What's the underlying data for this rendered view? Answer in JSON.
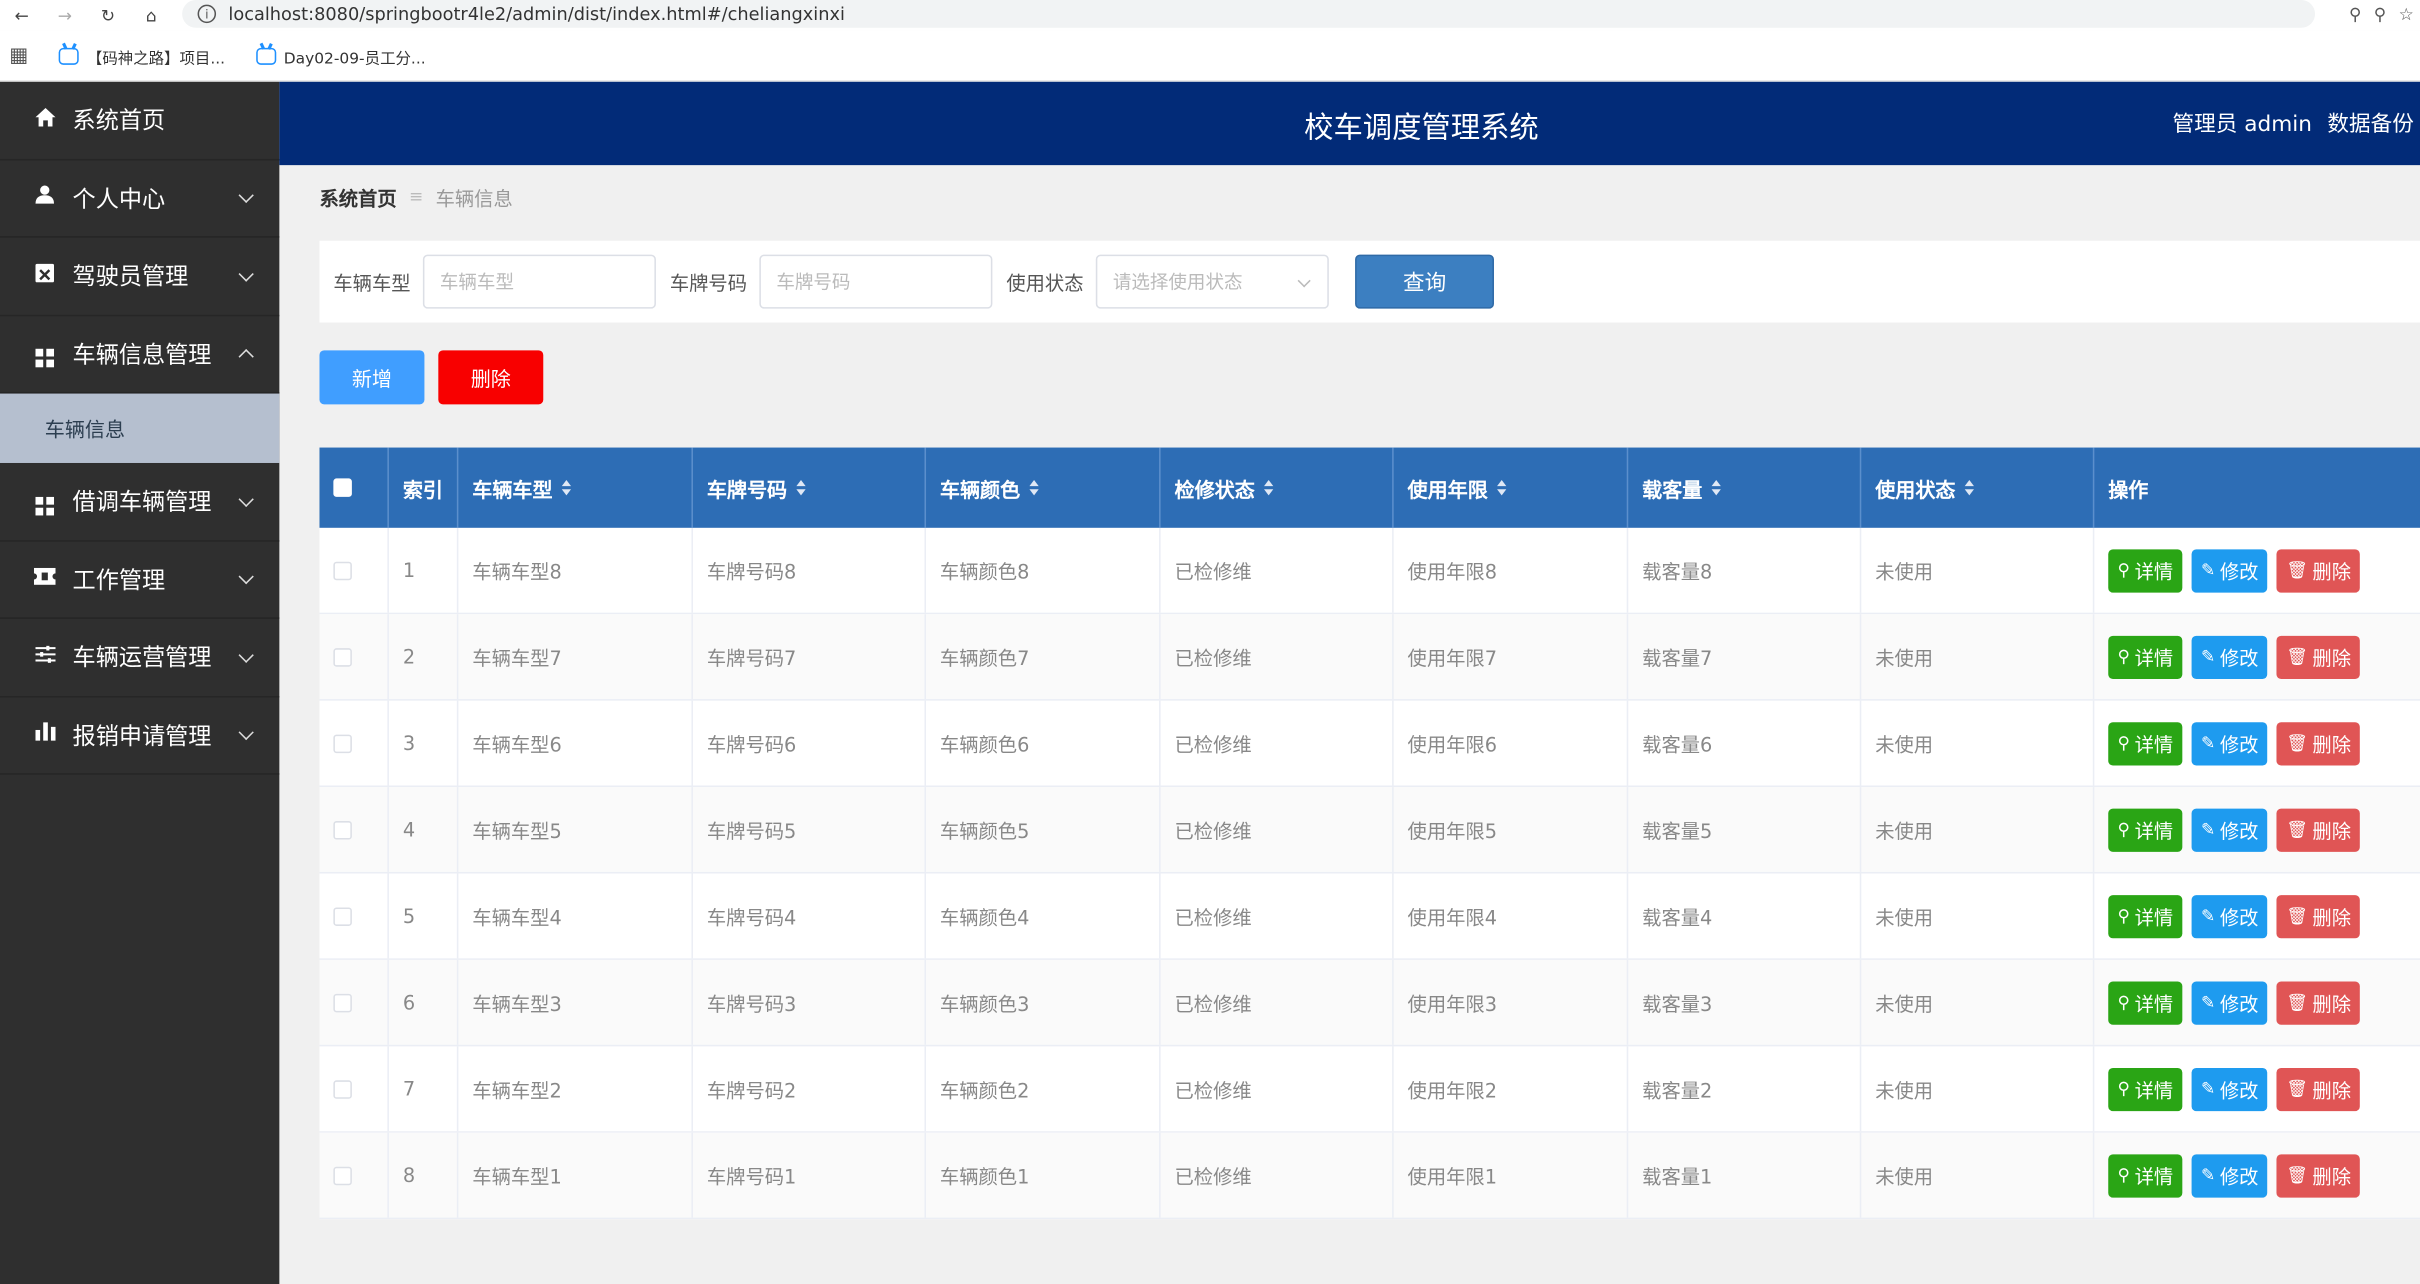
{
  "browser": {
    "url": "localhost:8080/springbootr4le2/admin/dist/index.html#/cheliangxinxi",
    "bookmarks": [
      "【码神之路】项目...",
      "Day02-09-员工分..."
    ]
  },
  "header": {
    "title": "校车调度管理系统",
    "user": "管理员 admin",
    "backup": "数据备份"
  },
  "sidebar": {
    "items": [
      {
        "label": "系统首页",
        "icon": "home-icon"
      },
      {
        "label": "个人中心",
        "icon": "user-icon"
      },
      {
        "label": "驾驶员管理",
        "icon": "id-card-icon"
      },
      {
        "label": "车辆信息管理",
        "icon": "grid-icon",
        "expanded": true,
        "sub": "车辆信息"
      },
      {
        "label": "借调车辆管理",
        "icon": "grid-icon"
      },
      {
        "label": "工作管理",
        "icon": "ticket-icon"
      },
      {
        "label": "车辆运营管理",
        "icon": "sliders-icon"
      },
      {
        "label": "报销申请管理",
        "icon": "bar-chart-icon"
      }
    ]
  },
  "breadcrumb": {
    "home": "系统首页",
    "current": "车辆信息"
  },
  "search": {
    "type_label": "车辆车型",
    "type_placeholder": "车辆车型",
    "plate_label": "车牌号码",
    "plate_placeholder": "车牌号码",
    "status_label": "使用状态",
    "status_placeholder": "请选择使用状态",
    "query": "查询"
  },
  "actions": {
    "add": "新增",
    "delete": "删除"
  },
  "table": {
    "columns": [
      "索引",
      "车辆车型",
      "车牌号码",
      "车辆颜色",
      "检修状态",
      "使用年限",
      "载客量",
      "使用状态",
      "操作"
    ],
    "ops": {
      "detail": "详情",
      "edit": "修改",
      "remove": "删除"
    },
    "rows": [
      [
        "1",
        "车辆车型8",
        "车牌号码8",
        "车辆颜色8",
        "已检修维",
        "使用年限8",
        "载客量8",
        "未使用"
      ],
      [
        "2",
        "车辆车型7",
        "车牌号码7",
        "车辆颜色7",
        "已检修维",
        "使用年限7",
        "载客量7",
        "未使用"
      ],
      [
        "3",
        "车辆车型6",
        "车牌号码6",
        "车辆颜色6",
        "已检修维",
        "使用年限6",
        "载客量6",
        "未使用"
      ],
      [
        "4",
        "车辆车型5",
        "车牌号码5",
        "车辆颜色5",
        "已检修维",
        "使用年限5",
        "载客量5",
        "未使用"
      ],
      [
        "5",
        "车辆车型4",
        "车牌号码4",
        "车辆颜色4",
        "已检修维",
        "使用年限4",
        "载客量4",
        "未使用"
      ],
      [
        "6",
        "车辆车型3",
        "车牌号码3",
        "车辆颜色3",
        "已检修维",
        "使用年限3",
        "载客量3",
        "未使用"
      ],
      [
        "7",
        "车辆车型2",
        "车牌号码2",
        "车辆颜色2",
        "已检修维",
        "使用年限2",
        "载客量2",
        "未使用"
      ],
      [
        "8",
        "车辆车型1",
        "车牌号码1",
        "车辆颜色1",
        "已检修维",
        "使用年限1",
        "载客量1",
        "未使用"
      ]
    ]
  },
  "colors": {
    "header_bg": "#022b78",
    "sidebar_bg": "#2f2f2f",
    "table_head": "#2d6db5",
    "add": "#409eff",
    "delete": "#f80000"
  }
}
